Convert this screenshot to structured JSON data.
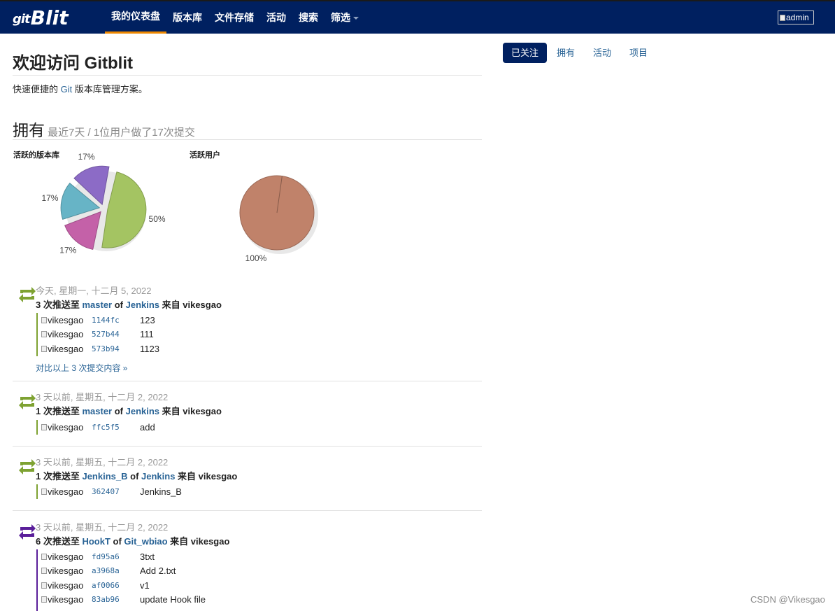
{
  "navbar": {
    "logo_prefix": "git",
    "logo_main": "Blit",
    "items": [
      {
        "label": "我的仪表盘",
        "active": true
      },
      {
        "label": "版本库",
        "active": false
      },
      {
        "label": "文件存储",
        "active": false
      },
      {
        "label": "活动",
        "active": false
      },
      {
        "label": "搜索",
        "active": false
      },
      {
        "label": "筛选",
        "active": false,
        "dropdown": true
      }
    ],
    "avatar_alt": "admin"
  },
  "header": {
    "title": "欢迎访问 Gitblit",
    "subtitle_before": "快速便捷的 ",
    "subtitle_link": "Git",
    "subtitle_after": " 版本库管理方案。"
  },
  "tabs": [
    "已关注",
    "拥有",
    "活动",
    "项目"
  ],
  "section": {
    "title": "拥有",
    "summary": "最近7天 / 1位用户做了17次提交"
  },
  "charts": {
    "repos_label": "活跃的版本库",
    "users_label": "活跃用户"
  },
  "chart_data": [
    {
      "type": "pie",
      "title": "活跃的版本库",
      "values": [
        50,
        17,
        17,
        17
      ],
      "labels": [
        "50%",
        "17%",
        "17%",
        "17%"
      ],
      "colors": [
        "#a4c462",
        "#c461a8",
        "#67b4c6",
        "#8c6bc6"
      ]
    },
    {
      "type": "pie",
      "title": "活跃用户",
      "values": [
        100
      ],
      "labels": [
        "100%"
      ],
      "colors": [
        "#c0826a"
      ]
    }
  ],
  "activities": [
    {
      "date": "今天, 星期一, 十二月 5, 2022",
      "count": "3 次推送至 ",
      "ref": "master",
      "of": " of ",
      "repo": "Jenkins",
      "from": " 来自 vikesgao",
      "icon_color": "#7ea232",
      "commits": [
        {
          "author": "vikesgao",
          "sha": "1144fc",
          "msg": "123"
        },
        {
          "author": "vikesgao",
          "sha": "527b44",
          "msg": "111"
        },
        {
          "author": "vikesgao",
          "sha": "573b94",
          "msg": "1123"
        }
      ],
      "compare": "对比以上 3 次提交内容 »"
    },
    {
      "date": "3 天以前, 星期五, 十二月 2, 2022",
      "count": "1 次推送至 ",
      "ref": "master",
      "of": " of ",
      "repo": "Jenkins",
      "from": " 来自 vikesgao",
      "icon_color": "#7ea232",
      "commits": [
        {
          "author": "vikesgao",
          "sha": "ffc5f5",
          "msg": "add"
        }
      ]
    },
    {
      "date": "3 天以前, 星期五, 十二月 2, 2022",
      "count": "1 次推送至 ",
      "ref": "Jenkins_B",
      "of": " of ",
      "repo": "Jenkins",
      "from": " 来自 vikesgao",
      "icon_color": "#7ea232",
      "commits": [
        {
          "author": "vikesgao",
          "sha": "362407",
          "msg": "Jenkins_B"
        }
      ]
    },
    {
      "date": "3 天以前, 星期五, 十二月 2, 2022",
      "count": "6 次推送至 ",
      "ref": "HookT",
      "of": " of ",
      "repo": "Git_wbiao",
      "from": " 来自 vikesgao",
      "icon_color": "#5a1f9a",
      "commits": [
        {
          "author": "vikesgao",
          "sha": "fd95a6",
          "msg": "3txt"
        },
        {
          "author": "vikesgao",
          "sha": "a3968a",
          "msg": "Add 2.txt"
        },
        {
          "author": "vikesgao",
          "sha": "af0066",
          "msg": "v1"
        },
        {
          "author": "vikesgao",
          "sha": "83ab96",
          "msg": "update Hook file"
        }
      ]
    }
  ],
  "watermark": "CSDN @Vikesgao"
}
